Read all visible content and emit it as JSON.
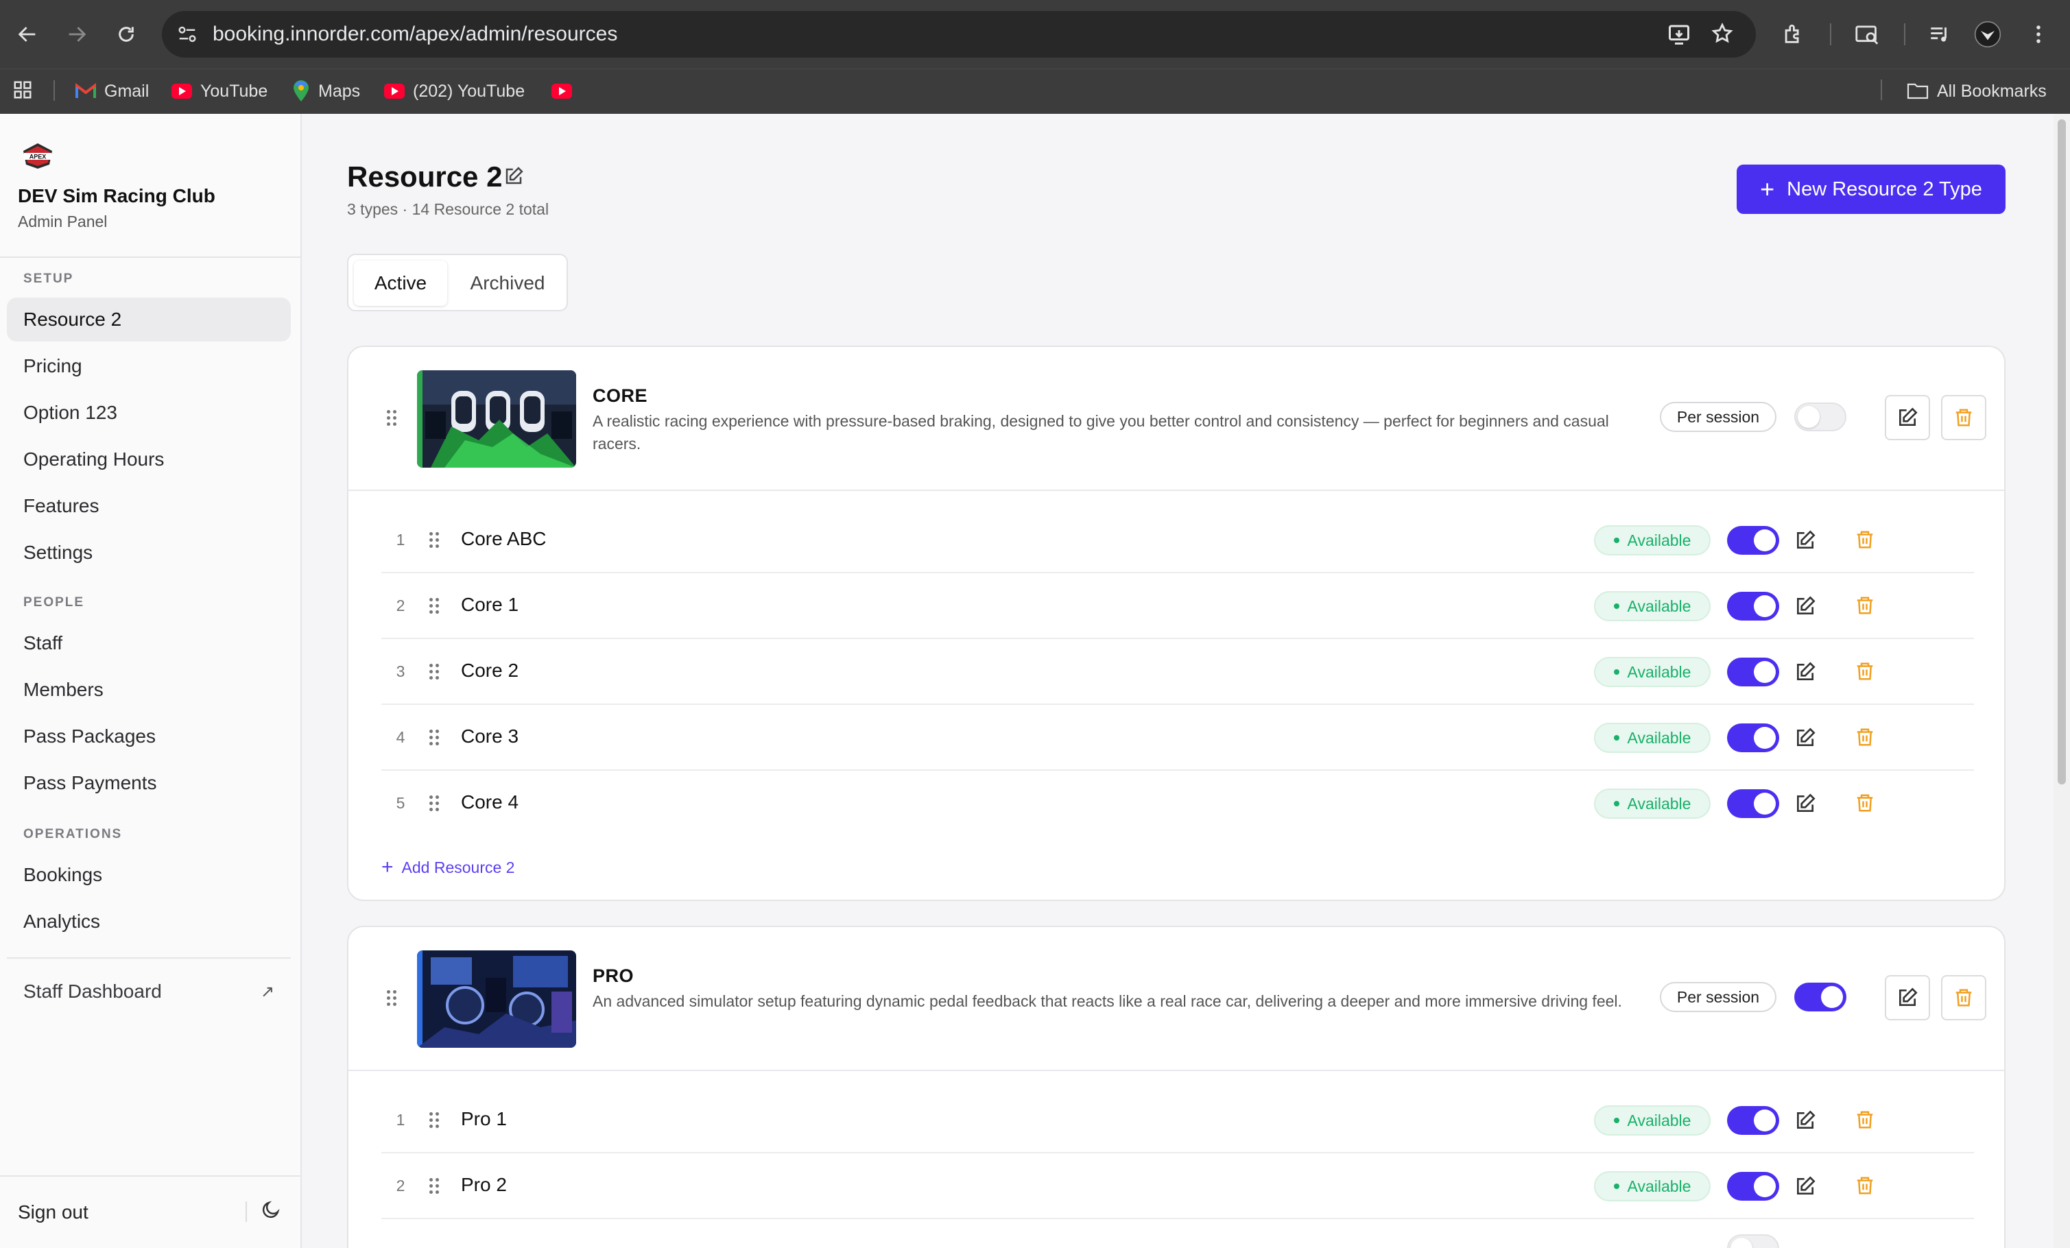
{
  "browser": {
    "url": "booking.innorder.com/apex/admin/resources",
    "bookmarks": [
      {
        "label": "Gmail",
        "icon": "gmail-icon"
      },
      {
        "label": "YouTube",
        "icon": "youtube-icon"
      },
      {
        "label": "Maps",
        "icon": "maps-icon"
      },
      {
        "label": "(202) YouTube",
        "icon": "youtube-icon"
      },
      {
        "label": "",
        "icon": "youtube-icon"
      }
    ],
    "all_bookmarks_label": "All Bookmarks"
  },
  "sidebar": {
    "club_name": "DEV Sim Racing Club",
    "subtitle": "Admin Panel",
    "sections": [
      {
        "title": "SETUP",
        "items": [
          {
            "label": "Resource 2",
            "active": true
          },
          {
            "label": "Pricing"
          },
          {
            "label": "Option 123"
          },
          {
            "label": "Operating Hours"
          },
          {
            "label": "Features"
          },
          {
            "label": "Settings"
          }
        ]
      },
      {
        "title": "PEOPLE",
        "items": [
          {
            "label": "Staff"
          },
          {
            "label": "Members"
          },
          {
            "label": "Pass Packages"
          },
          {
            "label": "Pass Payments"
          }
        ]
      },
      {
        "title": "OPERATIONS",
        "items": [
          {
            "label": "Bookings"
          },
          {
            "label": "Analytics"
          }
        ]
      }
    ],
    "staff_dashboard": "Staff Dashboard",
    "sign_out": "Sign out"
  },
  "page": {
    "title": "Resource 2",
    "subtitle": "3 types · 14 Resource 2 total",
    "new_button": "New Resource 2 Type",
    "tabs": [
      "Active",
      "Archived"
    ],
    "active_tab": "Active"
  },
  "types": [
    {
      "name": "CORE",
      "description": "A realistic racing experience with pressure-based braking, designed to give you better control and consistency — perfect for beginners and casual racers.",
      "pricing": "Per session",
      "enabled": false,
      "resources": [
        {
          "num": "1",
          "name": "Core ABC",
          "status": "Available",
          "enabled": true
        },
        {
          "num": "2",
          "name": "Core 1",
          "status": "Available",
          "enabled": true
        },
        {
          "num": "3",
          "name": "Core 2",
          "status": "Available",
          "enabled": true
        },
        {
          "num": "4",
          "name": "Core 3",
          "status": "Available",
          "enabled": true
        },
        {
          "num": "5",
          "name": "Core 4",
          "status": "Available",
          "enabled": true
        }
      ],
      "add_label": "Add Resource 2"
    },
    {
      "name": "PRO",
      "description": "An advanced simulator setup featuring dynamic pedal feedback that reacts like a real race car, delivering a deeper and more immersive driving feel.",
      "pricing": "Per session",
      "enabled": true,
      "resources": [
        {
          "num": "1",
          "name": "Pro 1",
          "status": "Available",
          "enabled": true
        },
        {
          "num": "2",
          "name": "Pro 2",
          "status": "Available",
          "enabled": true
        }
      ]
    }
  ],
  "colors": {
    "accent": "#4a2ff0",
    "available_text": "#18b06a",
    "delete_icon": "#f0a020"
  }
}
